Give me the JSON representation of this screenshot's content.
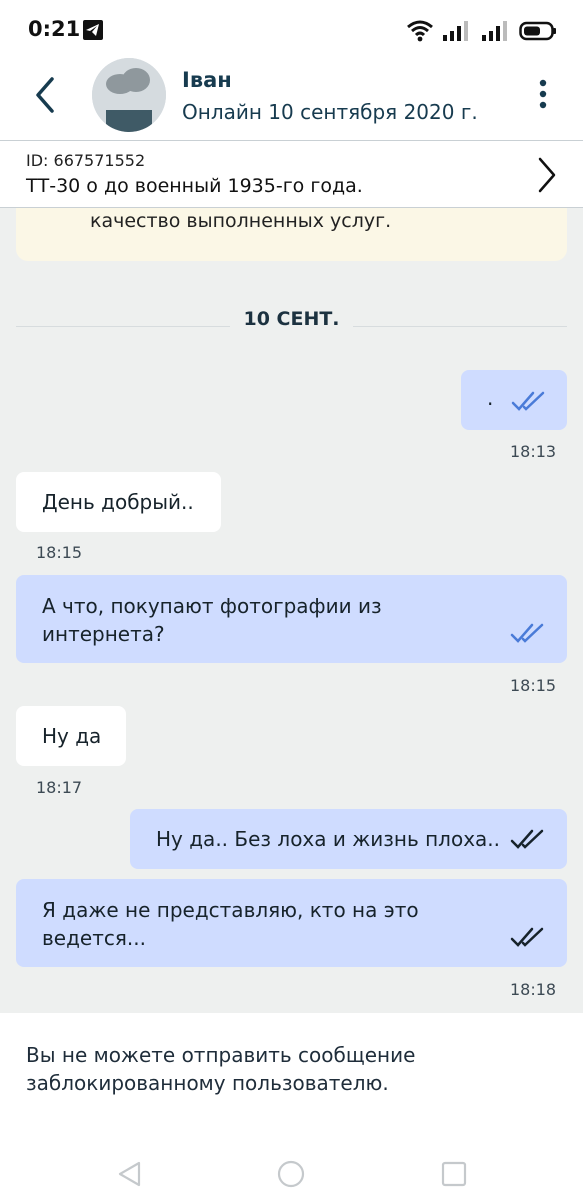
{
  "status_bar": {
    "time": "0:21",
    "icons": [
      "telegram-icon",
      "wifi-icon",
      "signal-icon",
      "signal-icon",
      "battery-icon"
    ]
  },
  "header": {
    "name": "Іван",
    "status": "Онлайн 10 сентября 2020 г.",
    "back_icon": "chevron-left-icon",
    "menu_icon": "more-vertical-icon"
  },
  "ad": {
    "id": "ID: 667571552",
    "title": "ТТ-30 о до военный 1935-го года."
  },
  "notice": {
    "text": "качество выполненных услуг."
  },
  "date_separator": "10 СЕНТ.",
  "messages": [
    {
      "direction": "out",
      "text": ".",
      "time": "18:13"
    },
    {
      "direction": "in",
      "text": "День добрый..",
      "time": "18:15"
    },
    {
      "direction": "out",
      "text_lines": [
        "А что, покупают фотографии из",
        "интернета?"
      ],
      "time": "18:15"
    },
    {
      "direction": "in",
      "text": "Ну да",
      "time": "18:17"
    },
    {
      "direction": "out",
      "text": "Ну да.. Без лоха и жизнь плоха..",
      "time": ""
    },
    {
      "direction": "out",
      "text_lines": [
        "Я даже не представляю, кто на это",
        "ведется..."
      ],
      "time": "18:18"
    }
  ],
  "footer": {
    "blocked_line1": "Вы не можете отправить сообщение",
    "blocked_line2": "заблокированному пользователю."
  },
  "colors": {
    "outgoing_bubble": "#cfdcff",
    "incoming_bubble": "#ffffff",
    "chat_background": "#eef0ef",
    "read_check_blue": "#4a7bd8",
    "read_check_dark": "#17232b",
    "notice_background": "#fbf7e6"
  }
}
